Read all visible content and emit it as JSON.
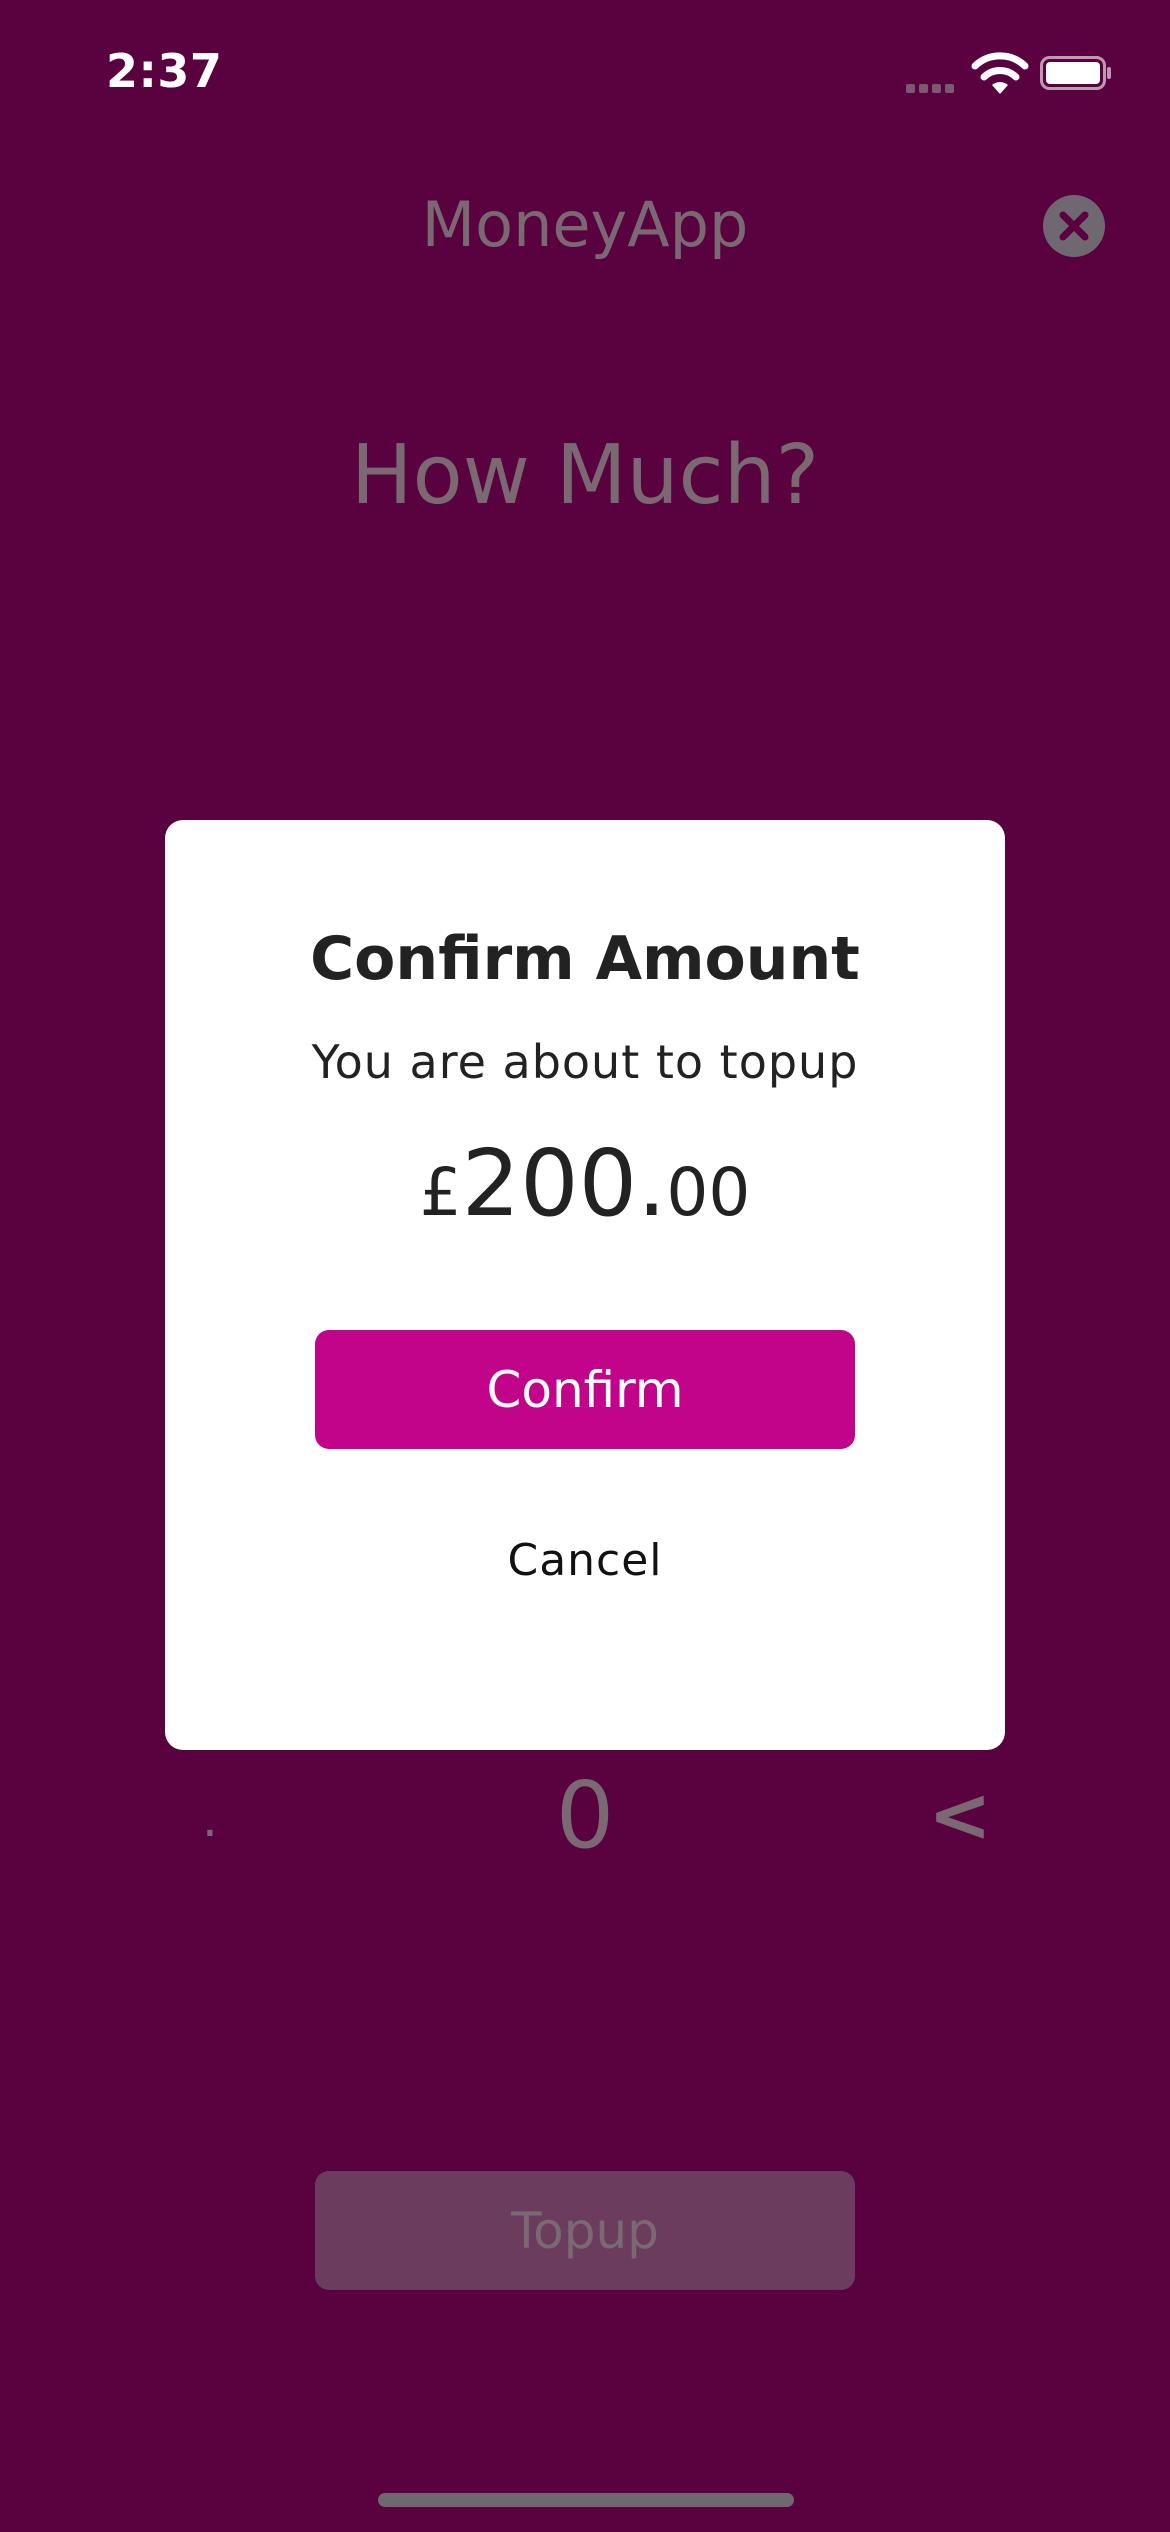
{
  "status_bar": {
    "time": "2:37"
  },
  "header": {
    "app_title": "MoneyApp",
    "close_icon": "close-circle-icon"
  },
  "main": {
    "prompt": "How Much?",
    "keypad": {
      "dot": ".",
      "zero": "0",
      "backspace": "<"
    },
    "topup_label": "Topup"
  },
  "modal": {
    "title": "Confirm Amount",
    "subtitle": "You are about to topup",
    "amount": {
      "currency": "£",
      "whole": "200.",
      "decimal": "00"
    },
    "confirm_label": "Confirm",
    "cancel_label": "Cancel"
  },
  "colors": {
    "background": "#5a0240",
    "accent": "#c2048b",
    "modal_background": "#ffffff",
    "disabled_button": "#6b3c5d"
  }
}
